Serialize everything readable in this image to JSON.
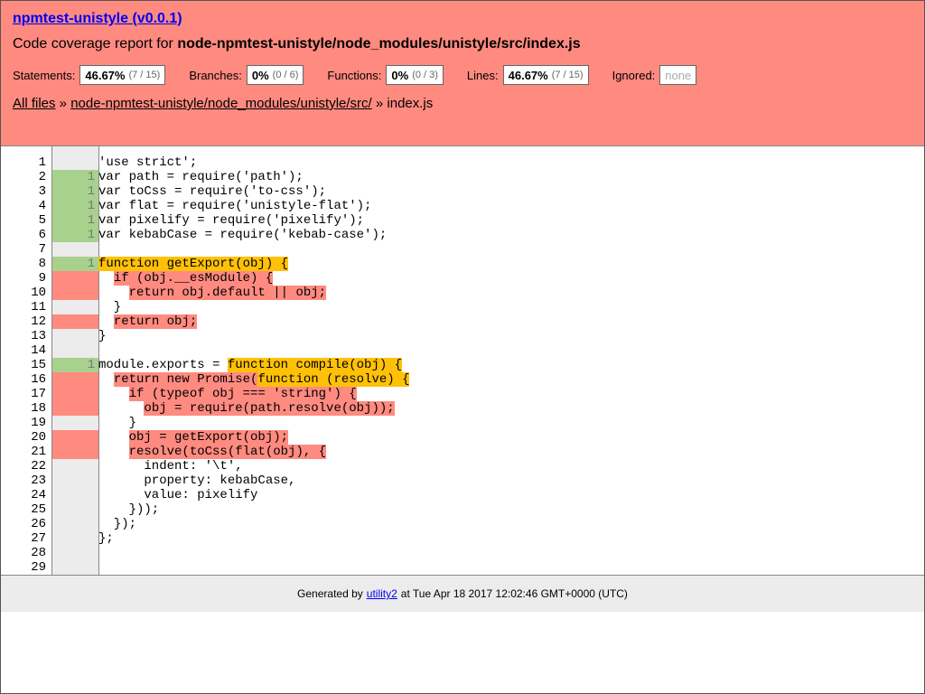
{
  "header": {
    "project_link": "npmtest-unistyle (v0.0.1)",
    "report_prefix": "Code coverage report for ",
    "report_path": "node-npmtest-unistyle/node_modules/unistyle/src/index.js",
    "stats": [
      {
        "label": "Statements:",
        "pct": "46.67%",
        "frac": "(7 / 15)"
      },
      {
        "label": "Branches:",
        "pct": "0%",
        "frac": "(0 / 6)"
      },
      {
        "label": "Functions:",
        "pct": "0%",
        "frac": "(0 / 3)"
      },
      {
        "label": "Lines:",
        "pct": "46.67%",
        "frac": "(7 / 15)"
      }
    ],
    "ignored_label": "Ignored:",
    "ignored_value": "none",
    "breadcrumb": {
      "all_files": "All files",
      "sep1": " » ",
      "dir": "node-npmtest-unistyle/node_modules/unistyle/src/",
      "sep2": " » ",
      "file": "index.js"
    }
  },
  "code": {
    "lines": [
      {
        "n": "1",
        "hits": "",
        "status": "neutral",
        "segments": [
          {
            "t": "'use strict';",
            "h": ""
          }
        ]
      },
      {
        "n": "2",
        "hits": "1",
        "status": "covered",
        "segments": [
          {
            "t": "var path = require('path');",
            "h": ""
          }
        ]
      },
      {
        "n": "3",
        "hits": "1",
        "status": "covered",
        "segments": [
          {
            "t": "var toCss = require('to-css');",
            "h": ""
          }
        ]
      },
      {
        "n": "4",
        "hits": "1",
        "status": "covered",
        "segments": [
          {
            "t": "var flat = require('unistyle-flat');",
            "h": ""
          }
        ]
      },
      {
        "n": "5",
        "hits": "1",
        "status": "covered",
        "segments": [
          {
            "t": "var pixelify = require('pixelify');",
            "h": ""
          }
        ]
      },
      {
        "n": "6",
        "hits": "1",
        "status": "covered",
        "segments": [
          {
            "t": "var kebabCase = require('kebab-case');",
            "h": ""
          }
        ]
      },
      {
        "n": "7",
        "hits": "",
        "status": "neutral",
        "segments": [
          {
            "t": "",
            "h": ""
          }
        ]
      },
      {
        "n": "8",
        "hits": "1",
        "status": "covered",
        "segments": [
          {
            "t": "function getExport(obj) {",
            "h": "yellow"
          }
        ]
      },
      {
        "n": "9",
        "hits": "",
        "status": "uncovered",
        "segments": [
          {
            "t": "  ",
            "h": ""
          },
          {
            "t": "if (obj.__esModule) {",
            "h": "red"
          }
        ]
      },
      {
        "n": "10",
        "hits": "",
        "status": "uncovered",
        "segments": [
          {
            "t": "    ",
            "h": ""
          },
          {
            "t": "return obj.default || obj;",
            "h": "red"
          }
        ]
      },
      {
        "n": "11",
        "hits": "",
        "status": "neutral",
        "segments": [
          {
            "t": "  }",
            "h": ""
          }
        ]
      },
      {
        "n": "12",
        "hits": "",
        "status": "uncovered",
        "segments": [
          {
            "t": "  ",
            "h": ""
          },
          {
            "t": "return obj;",
            "h": "red"
          }
        ]
      },
      {
        "n": "13",
        "hits": "",
        "status": "neutral",
        "segments": [
          {
            "t": "}",
            "h": ""
          }
        ]
      },
      {
        "n": "14",
        "hits": "",
        "status": "neutral",
        "segments": [
          {
            "t": "",
            "h": ""
          }
        ]
      },
      {
        "n": "15",
        "hits": "1",
        "status": "covered",
        "segments": [
          {
            "t": "module.exports = ",
            "h": ""
          },
          {
            "t": "function compile(obj) {",
            "h": "yellow"
          }
        ]
      },
      {
        "n": "16",
        "hits": "",
        "status": "uncovered",
        "segments": [
          {
            "t": "  ",
            "h": ""
          },
          {
            "t": "return new Promise(",
            "h": "red"
          },
          {
            "t": "function (resolve) {",
            "h": "yellow"
          }
        ]
      },
      {
        "n": "17",
        "hits": "",
        "status": "uncovered",
        "segments": [
          {
            "t": "    ",
            "h": ""
          },
          {
            "t": "if (typeof obj === 'string') {",
            "h": "red"
          }
        ]
      },
      {
        "n": "18",
        "hits": "",
        "status": "uncovered",
        "segments": [
          {
            "t": "      ",
            "h": ""
          },
          {
            "t": "obj = require(path.resolve(obj));",
            "h": "red"
          }
        ]
      },
      {
        "n": "19",
        "hits": "",
        "status": "neutral",
        "segments": [
          {
            "t": "    }",
            "h": ""
          }
        ]
      },
      {
        "n": "20",
        "hits": "",
        "status": "uncovered",
        "segments": [
          {
            "t": "    ",
            "h": ""
          },
          {
            "t": "obj = getExport(obj);",
            "h": "red"
          }
        ]
      },
      {
        "n": "21",
        "hits": "",
        "status": "uncovered",
        "segments": [
          {
            "t": "    ",
            "h": ""
          },
          {
            "t": "resolve(toCss(flat(obj), {",
            "h": "red"
          }
        ]
      },
      {
        "n": "22",
        "hits": "",
        "status": "neutral",
        "segments": [
          {
            "t": "      indent: '\\t',",
            "h": ""
          }
        ]
      },
      {
        "n": "23",
        "hits": "",
        "status": "neutral",
        "segments": [
          {
            "t": "      property: kebabCase,",
            "h": ""
          }
        ]
      },
      {
        "n": "24",
        "hits": "",
        "status": "neutral",
        "segments": [
          {
            "t": "      value: pixelify",
            "h": ""
          }
        ]
      },
      {
        "n": "25",
        "hits": "",
        "status": "neutral",
        "segments": [
          {
            "t": "    }));",
            "h": ""
          }
        ]
      },
      {
        "n": "26",
        "hits": "",
        "status": "neutral",
        "segments": [
          {
            "t": "  });",
            "h": ""
          }
        ]
      },
      {
        "n": "27",
        "hits": "",
        "status": "neutral",
        "segments": [
          {
            "t": "};",
            "h": ""
          }
        ]
      },
      {
        "n": "28",
        "hits": "",
        "status": "neutral",
        "segments": [
          {
            "t": "",
            "h": ""
          }
        ]
      },
      {
        "n": "29",
        "hits": "",
        "status": "neutral",
        "segments": [
          {
            "t": "",
            "h": ""
          }
        ]
      }
    ]
  },
  "footer": {
    "prefix": "Generated by",
    "link": "utility2",
    "suffix": "at Tue Apr 18 2017 12:02:46 GMT+0000 (UTC)"
  }
}
